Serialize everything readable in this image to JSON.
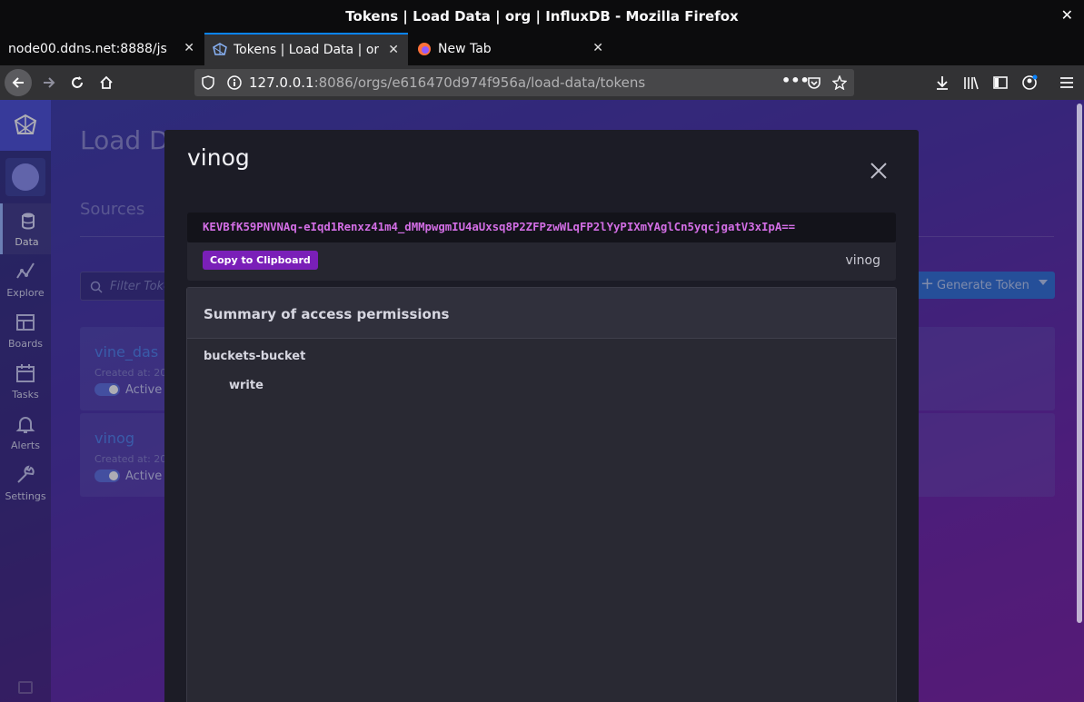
{
  "window": {
    "title": "Tokens | Load Data | org | InfluxDB - Mozilla Firefox"
  },
  "tabs": [
    {
      "label": "node00.ddns.net:8888/js",
      "active": false
    },
    {
      "label": "Tokens | Load Data | or",
      "active": true
    },
    {
      "label": "New Tab",
      "active": false
    }
  ],
  "urlbar": {
    "host": "127.0.0.1",
    "path": ":8086/orgs/e616470d974f956a/load-data/tokens"
  },
  "sidebar": {
    "items": [
      {
        "label": "Data",
        "icon": "database-icon",
        "active": true
      },
      {
        "label": "Explore",
        "icon": "graph-line-icon",
        "active": false
      },
      {
        "label": "Boards",
        "icon": "dashboard-grid-icon",
        "active": false
      },
      {
        "label": "Tasks",
        "icon": "calendar-icon",
        "active": false
      },
      {
        "label": "Alerts",
        "icon": "bell-icon",
        "active": false
      },
      {
        "label": "Settings",
        "icon": "wrench-icon",
        "active": false
      }
    ]
  },
  "page": {
    "title": "Load D",
    "tab": "Sources",
    "filter_placeholder": "Filter Toke",
    "generate_label": "Generate Token",
    "tokens": [
      {
        "name": "vine_das",
        "created": "Created at: 20",
        "status": "Active"
      },
      {
        "name": "vinog",
        "created": "Created at: 20",
        "status": "Active"
      }
    ]
  },
  "modal": {
    "title": "vinog",
    "token": "KEVBfK59PNVNAq-eIqd1Renxz41m4_dMMpwgmIU4aUxsq8P2ZFPzwWLqFP2lYyPIXmYAglCn5yqcjgatV3xIpA==",
    "copy_label": "Copy to Clipboard",
    "description": "vinog",
    "permissions": {
      "title": "Summary of access permissions",
      "resource": "buckets-bucket",
      "action": "write"
    }
  },
  "colors": {
    "accent": "#7a1fb8",
    "token_text": "#d36ee5",
    "firefox_active_tab": "#0a84ff"
  }
}
